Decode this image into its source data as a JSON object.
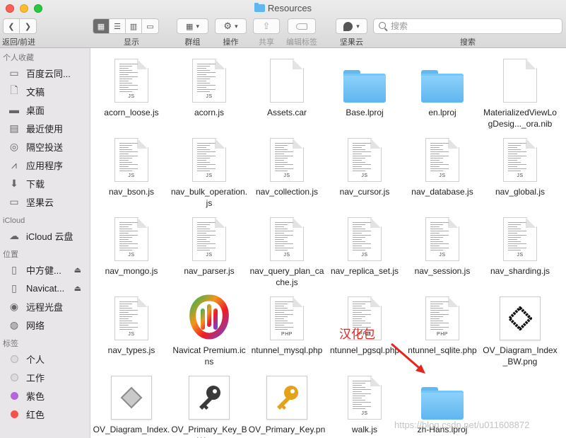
{
  "window": {
    "title": "Resources",
    "title_icon": "folder-icon",
    "colors": {
      "close": "#fe5f57",
      "minimize": "#febc2e",
      "maximize": "#28c840"
    }
  },
  "toolbar": {
    "back_label": "返回/前进",
    "view_label": "显示",
    "group_label": "群组",
    "action_label": "操作",
    "share_label": "共享",
    "edit_tags_label": "编辑标签",
    "jianguoyun_label": "坚果云",
    "search_label": "搜索",
    "search_placeholder": "搜索"
  },
  "sidebar": {
    "favorites_header": "个人收藏",
    "favorites": [
      {
        "label": "百度云同...",
        "icon": "folder-icon"
      },
      {
        "label": "文稿",
        "icon": "document-icon"
      },
      {
        "label": "桌面",
        "icon": "desktop-icon"
      },
      {
        "label": "最近使用",
        "icon": "recents-icon"
      },
      {
        "label": "隔空投送",
        "icon": "airdrop-icon"
      },
      {
        "label": "应用程序",
        "icon": "applications-icon"
      },
      {
        "label": "下载",
        "icon": "download-icon"
      },
      {
        "label": "坚果云",
        "icon": "folder-icon"
      }
    ],
    "icloud_header": "iCloud",
    "icloud": [
      {
        "label": "iCloud 云盘",
        "icon": "cloud-icon"
      }
    ],
    "locations_header": "位置",
    "locations": [
      {
        "label": "中方健...",
        "icon": "drive-icon",
        "eject": "⏏"
      },
      {
        "label": "Navicat...",
        "icon": "drive-icon",
        "eject": "⏏"
      },
      {
        "label": "远程光盘",
        "icon": "disc-icon"
      },
      {
        "label": "网络",
        "icon": "network-icon"
      }
    ],
    "tags_header": "标签",
    "tags": [
      {
        "label": "个人",
        "color": "#d9d9d9"
      },
      {
        "label": "工作",
        "color": "#d9d9d9"
      },
      {
        "label": "紫色",
        "color": "#b467d8"
      },
      {
        "label": "红色",
        "color": "#f4534b"
      }
    ]
  },
  "files": [
    {
      "name": "acorn_loose.js",
      "kind": "doc",
      "ext": "JS"
    },
    {
      "name": "acorn.js",
      "kind": "doc",
      "ext": "JS"
    },
    {
      "name": "Assets.car",
      "kind": "blank",
      "ext": ""
    },
    {
      "name": "Base.lproj",
      "kind": "folder",
      "ext": ""
    },
    {
      "name": "en.lproj",
      "kind": "folder",
      "ext": ""
    },
    {
      "name": "MaterializedViewLogDesig..._ora.nib",
      "kind": "blank",
      "ext": ""
    },
    {
      "name": "nav_bson.js",
      "kind": "doc",
      "ext": "JS"
    },
    {
      "name": "nav_bulk_operation.js",
      "kind": "doc",
      "ext": "JS"
    },
    {
      "name": "nav_collection.js",
      "kind": "doc",
      "ext": "JS"
    },
    {
      "name": "nav_cursor.js",
      "kind": "doc",
      "ext": "JS"
    },
    {
      "name": "nav_database.js",
      "kind": "doc",
      "ext": "JS"
    },
    {
      "name": "nav_global.js",
      "kind": "doc",
      "ext": "JS"
    },
    {
      "name": "nav_mongo.js",
      "kind": "doc",
      "ext": "JS"
    },
    {
      "name": "nav_parser.js",
      "kind": "doc",
      "ext": "JS"
    },
    {
      "name": "nav_query_plan_cache.js",
      "kind": "doc",
      "ext": "JS"
    },
    {
      "name": "nav_replica_set.js",
      "kind": "doc",
      "ext": "JS"
    },
    {
      "name": "nav_session.js",
      "kind": "doc",
      "ext": "JS"
    },
    {
      "name": "nav_sharding.js",
      "kind": "doc",
      "ext": "JS"
    },
    {
      "name": "nav_types.js",
      "kind": "doc",
      "ext": "JS"
    },
    {
      "name": "Navicat Premium.icns",
      "kind": "navicat",
      "ext": ""
    },
    {
      "name": "ntunnel_mysql.php",
      "kind": "doc",
      "ext": "PHP"
    },
    {
      "name": "ntunnel_pgsql.php",
      "kind": "doc",
      "ext": "PHP"
    },
    {
      "name": "ntunnel_sqlite.php",
      "kind": "doc",
      "ext": "PHP"
    },
    {
      "name": "OV_Diagram_Index_BW.png",
      "kind": "diamond-bw",
      "ext": ""
    },
    {
      "name": "OV_Diagram_Index.png",
      "kind": "diamond-gray",
      "ext": ""
    },
    {
      "name": "OV_Primary_Key_BW.png",
      "kind": "key-bw",
      "ext": ""
    },
    {
      "name": "OV_Primary_Key.png",
      "kind": "key-gold",
      "ext": ""
    },
    {
      "name": "walk.js",
      "kind": "doc",
      "ext": "JS"
    },
    {
      "name": "zh-Hans.lproj",
      "kind": "folder",
      "ext": ""
    }
  ],
  "annotation": {
    "text": "汉化包",
    "color": "#e8231d"
  },
  "watermark": "https://blog.csdn.net/u011608872"
}
